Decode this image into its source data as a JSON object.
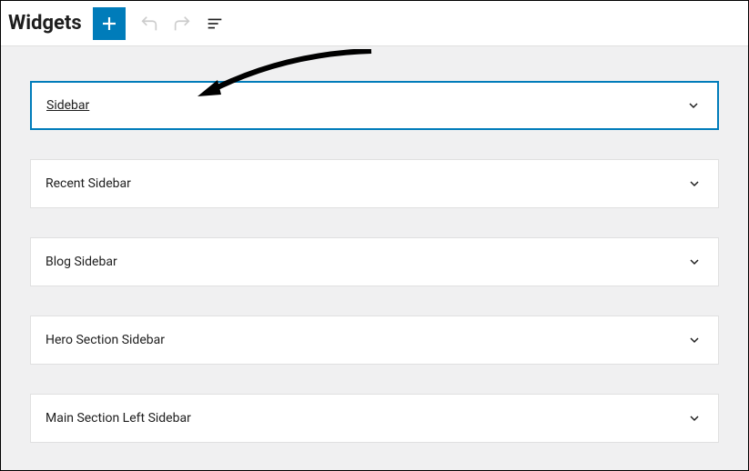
{
  "header": {
    "title": "Widgets"
  },
  "panels": [
    {
      "label": "Sidebar",
      "selected": true
    },
    {
      "label": "Recent Sidebar",
      "selected": false
    },
    {
      "label": "Blog Sidebar",
      "selected": false
    },
    {
      "label": "Hero Section Sidebar",
      "selected": false
    },
    {
      "label": "Main Section Left Sidebar",
      "selected": false
    }
  ]
}
